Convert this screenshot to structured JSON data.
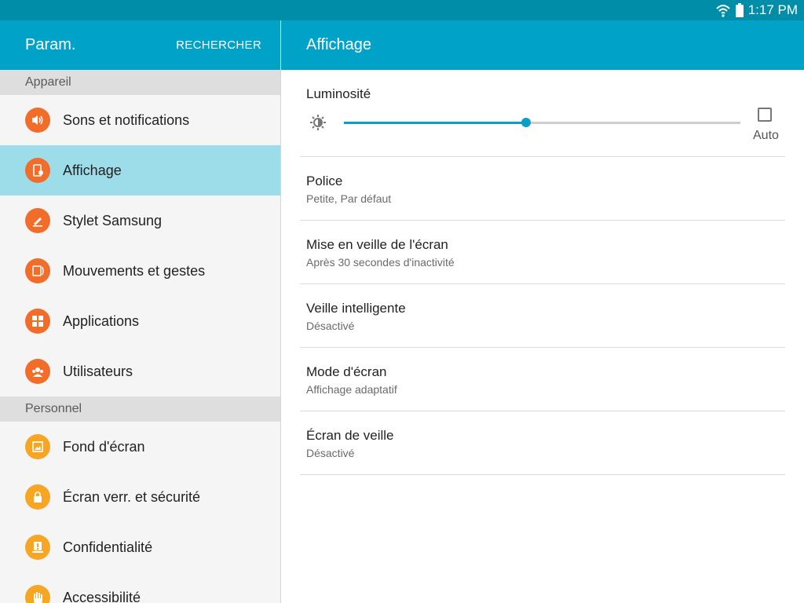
{
  "status_bar": {
    "time": "1:17 PM"
  },
  "app_bar": {
    "title": "Param.",
    "search_label": "RECHERCHER",
    "page_title": "Affichage"
  },
  "sidebar": {
    "sections": [
      {
        "header": "Appareil"
      },
      {
        "header": "Personnel"
      }
    ],
    "items": [
      {
        "label": "Sons et notifications",
        "icon": "speaker-icon",
        "color": "#f26c2a"
      },
      {
        "label": "Affichage",
        "icon": "display-icon",
        "color": "#f26c2a",
        "selected": true
      },
      {
        "label": "Stylet Samsung",
        "icon": "pen-icon",
        "color": "#f26c2a"
      },
      {
        "label": "Mouvements et gestes",
        "icon": "gesture-icon",
        "color": "#f26c2a"
      },
      {
        "label": "Applications",
        "icon": "apps-grid-icon",
        "color": "#f26c2a"
      },
      {
        "label": "Utilisateurs",
        "icon": "users-icon",
        "color": "#f26c2a"
      },
      {
        "label": "Fond d'écran",
        "icon": "wallpaper-icon",
        "color": "#f6a623"
      },
      {
        "label": "Écran verr. et sécurité",
        "icon": "lock-icon",
        "color": "#f6a623"
      },
      {
        "label": "Confidentialité",
        "icon": "privacy-icon",
        "color": "#f6a623"
      },
      {
        "label": "Accessibilité",
        "icon": "hand-icon",
        "color": "#f6a623"
      }
    ]
  },
  "content": {
    "brightness": {
      "label": "Luminosité",
      "level": 0.46,
      "auto_label": "Auto",
      "auto_checked": false
    },
    "settings": [
      {
        "title": "Police",
        "subtitle": "Petite, Par défaut"
      },
      {
        "title": "Mise en veille de l'écran",
        "subtitle": "Après 30 secondes d'inactivité"
      },
      {
        "title": "Veille intelligente",
        "subtitle": "Désactivé"
      },
      {
        "title": "Mode d'écran",
        "subtitle": "Affichage adaptatif"
      },
      {
        "title": "Écran de veille",
        "subtitle": "Désactivé"
      }
    ]
  },
  "colors": {
    "status_bar": "#008da8",
    "app_bar": "#00a2c8",
    "selected_item": "#9ddde9",
    "accent": "#0a9fc7"
  }
}
